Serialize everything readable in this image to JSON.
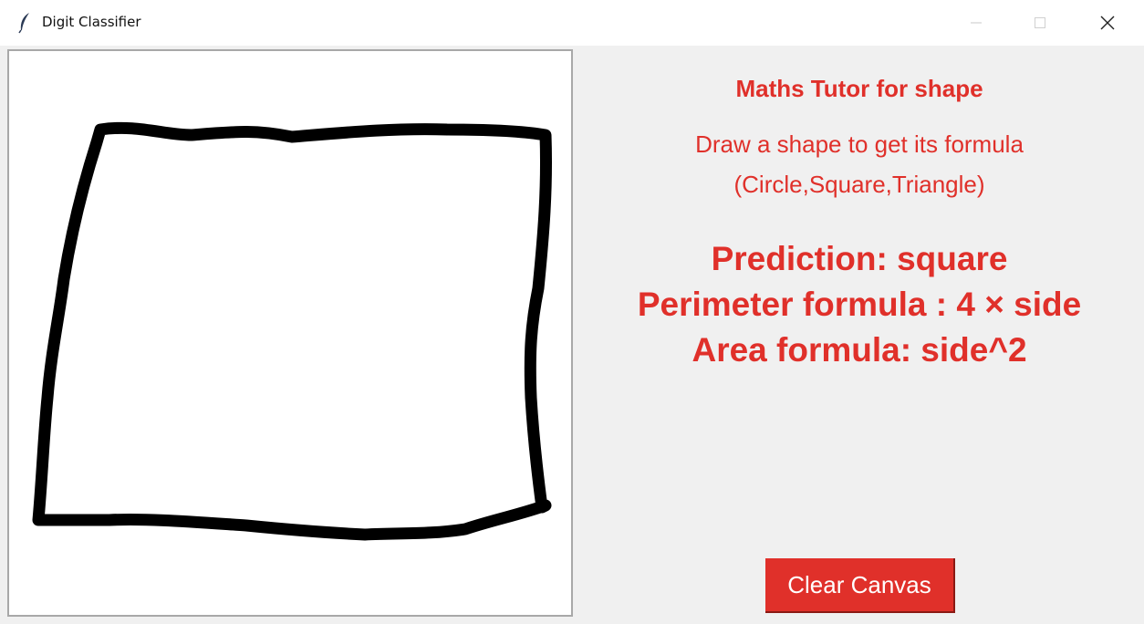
{
  "window": {
    "title": "Digit Classifier",
    "controls": {
      "minimize": "minimize-icon",
      "maximize": "maximize-icon",
      "close": "close-icon"
    }
  },
  "canvas": {
    "stroke_color": "#000000",
    "background": "#ffffff"
  },
  "panel": {
    "title": "Maths Tutor for shape",
    "instruction_line1": "Draw a shape to get its formula",
    "instruction_line2": "(Circle,Square,Triangle)",
    "prediction": "Prediction: square",
    "perimeter": "Perimeter formula : 4 × side",
    "area": "Area formula: side^2",
    "text_color": "#e0302a"
  },
  "buttons": {
    "clear_label": "Clear Canvas",
    "clear_color": "#e0302a"
  }
}
